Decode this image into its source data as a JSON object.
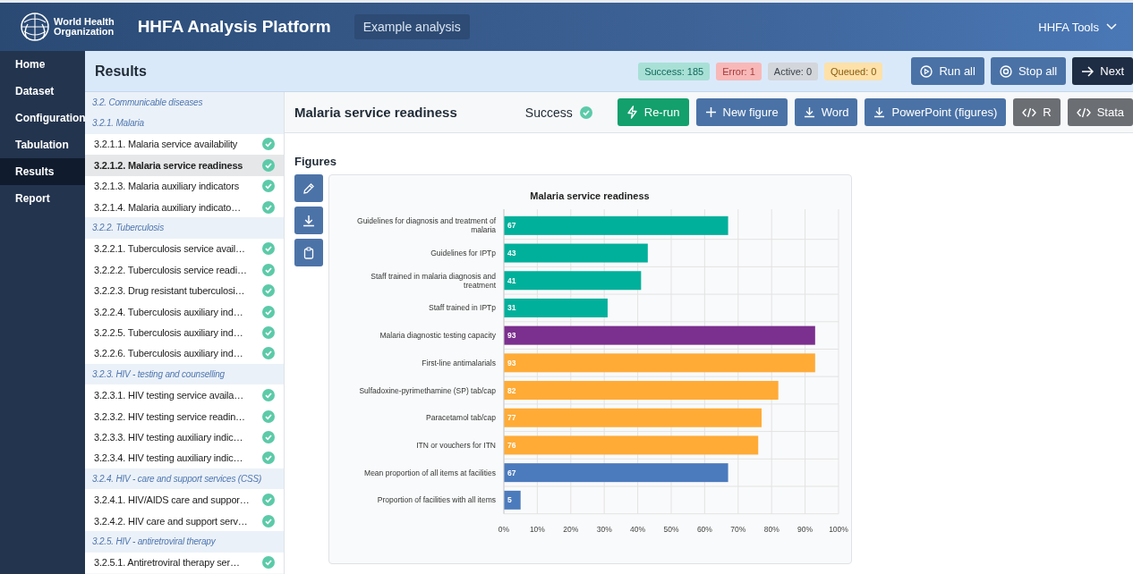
{
  "header": {
    "org_name": [
      "World Health",
      "Organization"
    ],
    "title": "HHFA Analysis Platform",
    "analysis": "Example analysis",
    "tools_menu": "HHFA Tools"
  },
  "nav": [
    {
      "label": "Home",
      "selected": false
    },
    {
      "label": "Dataset",
      "selected": false
    },
    {
      "label": "Configuration",
      "selected": false
    },
    {
      "label": "Tabulation",
      "selected": false
    },
    {
      "label": "Results",
      "selected": true
    },
    {
      "label": "Report",
      "selected": false
    }
  ],
  "results_bar": {
    "title": "Results",
    "badges": [
      {
        "kind": "success",
        "label": "Success: 185"
      },
      {
        "kind": "error",
        "label": "Error: 1"
      },
      {
        "kind": "active",
        "label": "Active: 0"
      },
      {
        "kind": "queued",
        "label": "Queued: 0"
      }
    ],
    "buttons": [
      {
        "kind": "run",
        "label": "Run all"
      },
      {
        "kind": "stop",
        "label": "Stop all"
      },
      {
        "kind": "next",
        "label": "Next"
      }
    ]
  },
  "sections": [
    {
      "kind": "header",
      "label": "3.2. Communicable diseases"
    },
    {
      "kind": "header",
      "label": "3.2.1. Malaria"
    },
    {
      "kind": "item",
      "label": "3.2.1.1. Malaria service availability",
      "selected": false,
      "complete": true
    },
    {
      "kind": "item",
      "label": "3.2.1.2. Malaria service readiness",
      "selected": true,
      "complete": true
    },
    {
      "kind": "item",
      "label": "3.2.1.3. Malaria auxiliary indicators",
      "selected": false,
      "complete": true
    },
    {
      "kind": "item",
      "label": "3.2.1.4. Malaria auxiliary indicato…",
      "selected": false,
      "complete": true
    },
    {
      "kind": "header",
      "label": "3.2.2. Tuberculosis"
    },
    {
      "kind": "item",
      "label": "3.2.2.1. Tuberculosis service avail…",
      "selected": false,
      "complete": true
    },
    {
      "kind": "item",
      "label": "3.2.2.2. Tuberculosis service readi…",
      "selected": false,
      "complete": true
    },
    {
      "kind": "item",
      "label": "3.2.2.3. Drug resistant tuberculosi…",
      "selected": false,
      "complete": true
    },
    {
      "kind": "item",
      "label": "3.2.2.4. Tuberculosis auxiliary ind…",
      "selected": false,
      "complete": true
    },
    {
      "kind": "item",
      "label": "3.2.2.5. Tuberculosis auxiliary ind…",
      "selected": false,
      "complete": true
    },
    {
      "kind": "item",
      "label": "3.2.2.6. Tuberculosis auxiliary ind…",
      "selected": false,
      "complete": true
    },
    {
      "kind": "header",
      "label": "3.2.3. HIV - testing and counselling"
    },
    {
      "kind": "item",
      "label": "3.2.3.1. HIV testing service availa…",
      "selected": false,
      "complete": true
    },
    {
      "kind": "item",
      "label": "3.2.3.2. HIV testing service readin…",
      "selected": false,
      "complete": true
    },
    {
      "kind": "item",
      "label": "3.2.3.3. HIV testing auxiliary indic…",
      "selected": false,
      "complete": true
    },
    {
      "kind": "item",
      "label": "3.2.3.4. HIV testing auxiliary indic…",
      "selected": false,
      "complete": true
    },
    {
      "kind": "header",
      "label": "3.2.4. HIV - care and support services (CSS)"
    },
    {
      "kind": "item",
      "label": "3.2.4.1. HIV/AIDS care and suppor…",
      "selected": false,
      "complete": true
    },
    {
      "kind": "item",
      "label": "3.2.4.2. HIV care and support serv…",
      "selected": false,
      "complete": true
    },
    {
      "kind": "header",
      "label": "3.2.5. HIV - antiretroviral therapy"
    },
    {
      "kind": "item",
      "label": "3.2.5.1. Antiretroviral therapy ser…",
      "selected": false,
      "complete": true
    }
  ],
  "analysis": {
    "title": "Malaria service readiness",
    "complete": true,
    "status_label": "Success",
    "buttons": [
      {
        "kind": "rerun",
        "label": "Re-run"
      },
      {
        "kind": "new",
        "label": "New figure"
      },
      {
        "kind": "download",
        "label": "Word"
      },
      {
        "kind": "download",
        "label": "PowerPoint (figures)"
      },
      {
        "kind": "code",
        "label": "R"
      },
      {
        "kind": "code",
        "label": "Stata"
      }
    ],
    "figures_heading": "Figures",
    "figure": {
      "chart_data": {
        "type": "bar",
        "orientation": "horizontal",
        "title": "Malaria service readiness",
        "data_labels": true,
        "grid": true,
        "categories": [
          "Guidelines for diagnosis and treatment of malaria",
          "Guidelines for IPTp",
          "Staff trained in malaria diagnosis and treatment",
          "Staff trained in IPTp",
          "Malaria diagnostic testing capacity",
          "First-line antimalarials",
          "Sulfadoxine-pyrimethamine (SP) tab/cap",
          "Paracetamol tab/cap",
          "ITN or vouchers for ITN",
          "Mean proportion of all items at facilities",
          "Proportion of facilities with all items"
        ],
        "series": [
          {
            "color": "#00b09b",
            "values": [
              67,
              43,
              41,
              31,
              null,
              null,
              null,
              null,
              null,
              null,
              null
            ]
          },
          {
            "color": "#7b2f8e",
            "values": [
              null,
              null,
              null,
              null,
              93,
              null,
              null,
              null,
              null,
              null,
              null
            ]
          },
          {
            "color": "#ffab36",
            "values": [
              null,
              null,
              null,
              null,
              null,
              93,
              82,
              77,
              76,
              null,
              null
            ]
          },
          {
            "color": "#4c7bbd",
            "values": [
              null,
              null,
              null,
              null,
              null,
              null,
              null,
              null,
              null,
              67,
              5
            ]
          }
        ],
        "xlim": [
          0,
          100
        ],
        "xticks": [
          {
            "value": 0,
            "label": "0%"
          },
          {
            "value": 10,
            "label": "10%"
          },
          {
            "value": 20,
            "label": "20%"
          },
          {
            "value": 30,
            "label": "30%"
          },
          {
            "value": 40,
            "label": "40%"
          },
          {
            "value": 50,
            "label": "50%"
          },
          {
            "value": 60,
            "label": "60%"
          },
          {
            "value": 70,
            "label": "70%"
          },
          {
            "value": 80,
            "label": "80%"
          },
          {
            "value": 90,
            "label": "90%"
          },
          {
            "value": 100,
            "label": "100%"
          }
        ]
      }
    }
  }
}
